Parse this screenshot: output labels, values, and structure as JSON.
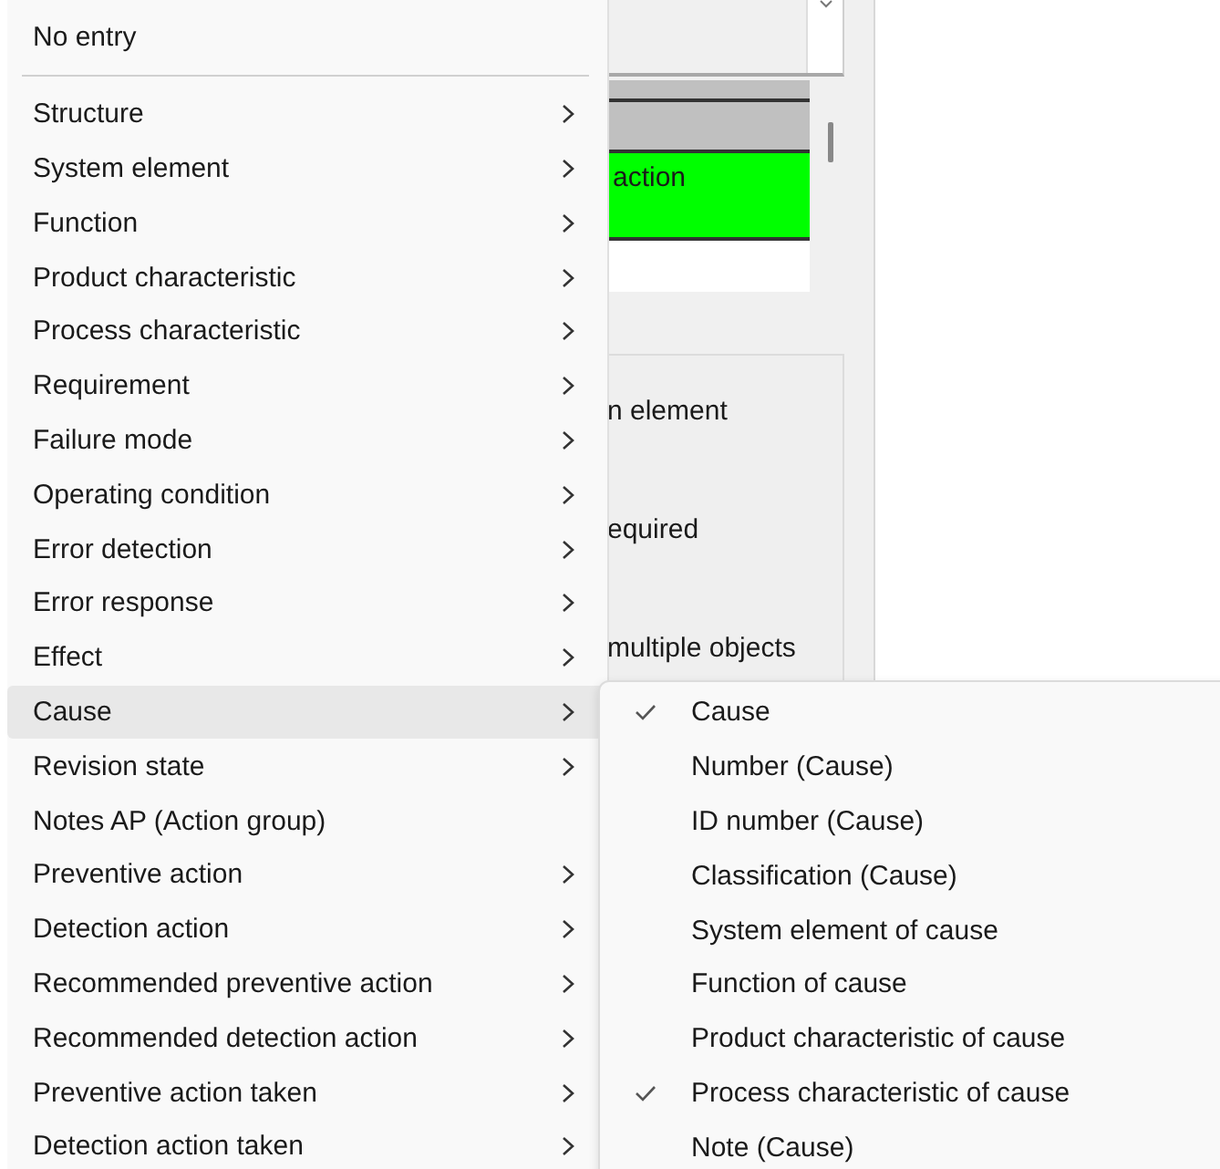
{
  "dialog": {
    "list_rows": [
      {
        "color": "#c0c0c0"
      },
      {
        "color": "#c0c0c0"
      },
      {
        "color": "#00ff00",
        "text": "action"
      },
      {
        "color": "#ffffff"
      }
    ],
    "options": [
      "n element",
      "equired",
      "multiple objects"
    ]
  },
  "menu": {
    "items": [
      {
        "kind": "item",
        "label": "No entry",
        "submenu": false,
        "highlighted": false
      },
      {
        "kind": "separator"
      },
      {
        "kind": "item",
        "label": "Structure",
        "submenu": true,
        "highlighted": false
      },
      {
        "kind": "item",
        "label": "System element",
        "submenu": true,
        "highlighted": false
      },
      {
        "kind": "item",
        "label": "Function",
        "submenu": true,
        "highlighted": false
      },
      {
        "kind": "item",
        "label": "Product characteristic",
        "submenu": true,
        "highlighted": false
      },
      {
        "kind": "item",
        "label": "Process characteristic",
        "submenu": true,
        "highlighted": false
      },
      {
        "kind": "item",
        "label": "Requirement",
        "submenu": true,
        "highlighted": false
      },
      {
        "kind": "item",
        "label": "Failure mode",
        "submenu": true,
        "highlighted": false
      },
      {
        "kind": "item",
        "label": "Operating condition",
        "submenu": true,
        "highlighted": false
      },
      {
        "kind": "item",
        "label": "Error detection",
        "submenu": true,
        "highlighted": false
      },
      {
        "kind": "item",
        "label": "Error response",
        "submenu": true,
        "highlighted": false
      },
      {
        "kind": "item",
        "label": "Effect",
        "submenu": true,
        "highlighted": false
      },
      {
        "kind": "item",
        "label": "Cause",
        "submenu": true,
        "highlighted": true
      },
      {
        "kind": "item",
        "label": "Revision state",
        "submenu": true,
        "highlighted": false
      },
      {
        "kind": "item",
        "label": "Notes AP (Action group)",
        "submenu": false,
        "highlighted": false
      },
      {
        "kind": "item",
        "label": "Preventive action",
        "submenu": true,
        "highlighted": false
      },
      {
        "kind": "item",
        "label": "Detection action",
        "submenu": true,
        "highlighted": false
      },
      {
        "kind": "item",
        "label": "Recommended preventive action",
        "submenu": true,
        "highlighted": false
      },
      {
        "kind": "item",
        "label": "Recommended detection action",
        "submenu": true,
        "highlighted": false
      },
      {
        "kind": "item",
        "label": "Preventive action taken",
        "submenu": true,
        "highlighted": false
      },
      {
        "kind": "item",
        "label": "Detection action taken",
        "submenu": true,
        "highlighted": false
      }
    ]
  },
  "submenu": {
    "items": [
      {
        "label": "Cause",
        "checked": true
      },
      {
        "label": "Number (Cause)",
        "checked": false
      },
      {
        "label": "ID number (Cause)",
        "checked": false
      },
      {
        "label": "Classification (Cause)",
        "checked": false
      },
      {
        "label": "System element of cause",
        "checked": false
      },
      {
        "label": "Function of cause",
        "checked": false
      },
      {
        "label": "Product characteristic of cause",
        "checked": false
      },
      {
        "label": "Process characteristic of cause",
        "checked": true
      },
      {
        "label": "Note (Cause)",
        "checked": false
      }
    ]
  }
}
